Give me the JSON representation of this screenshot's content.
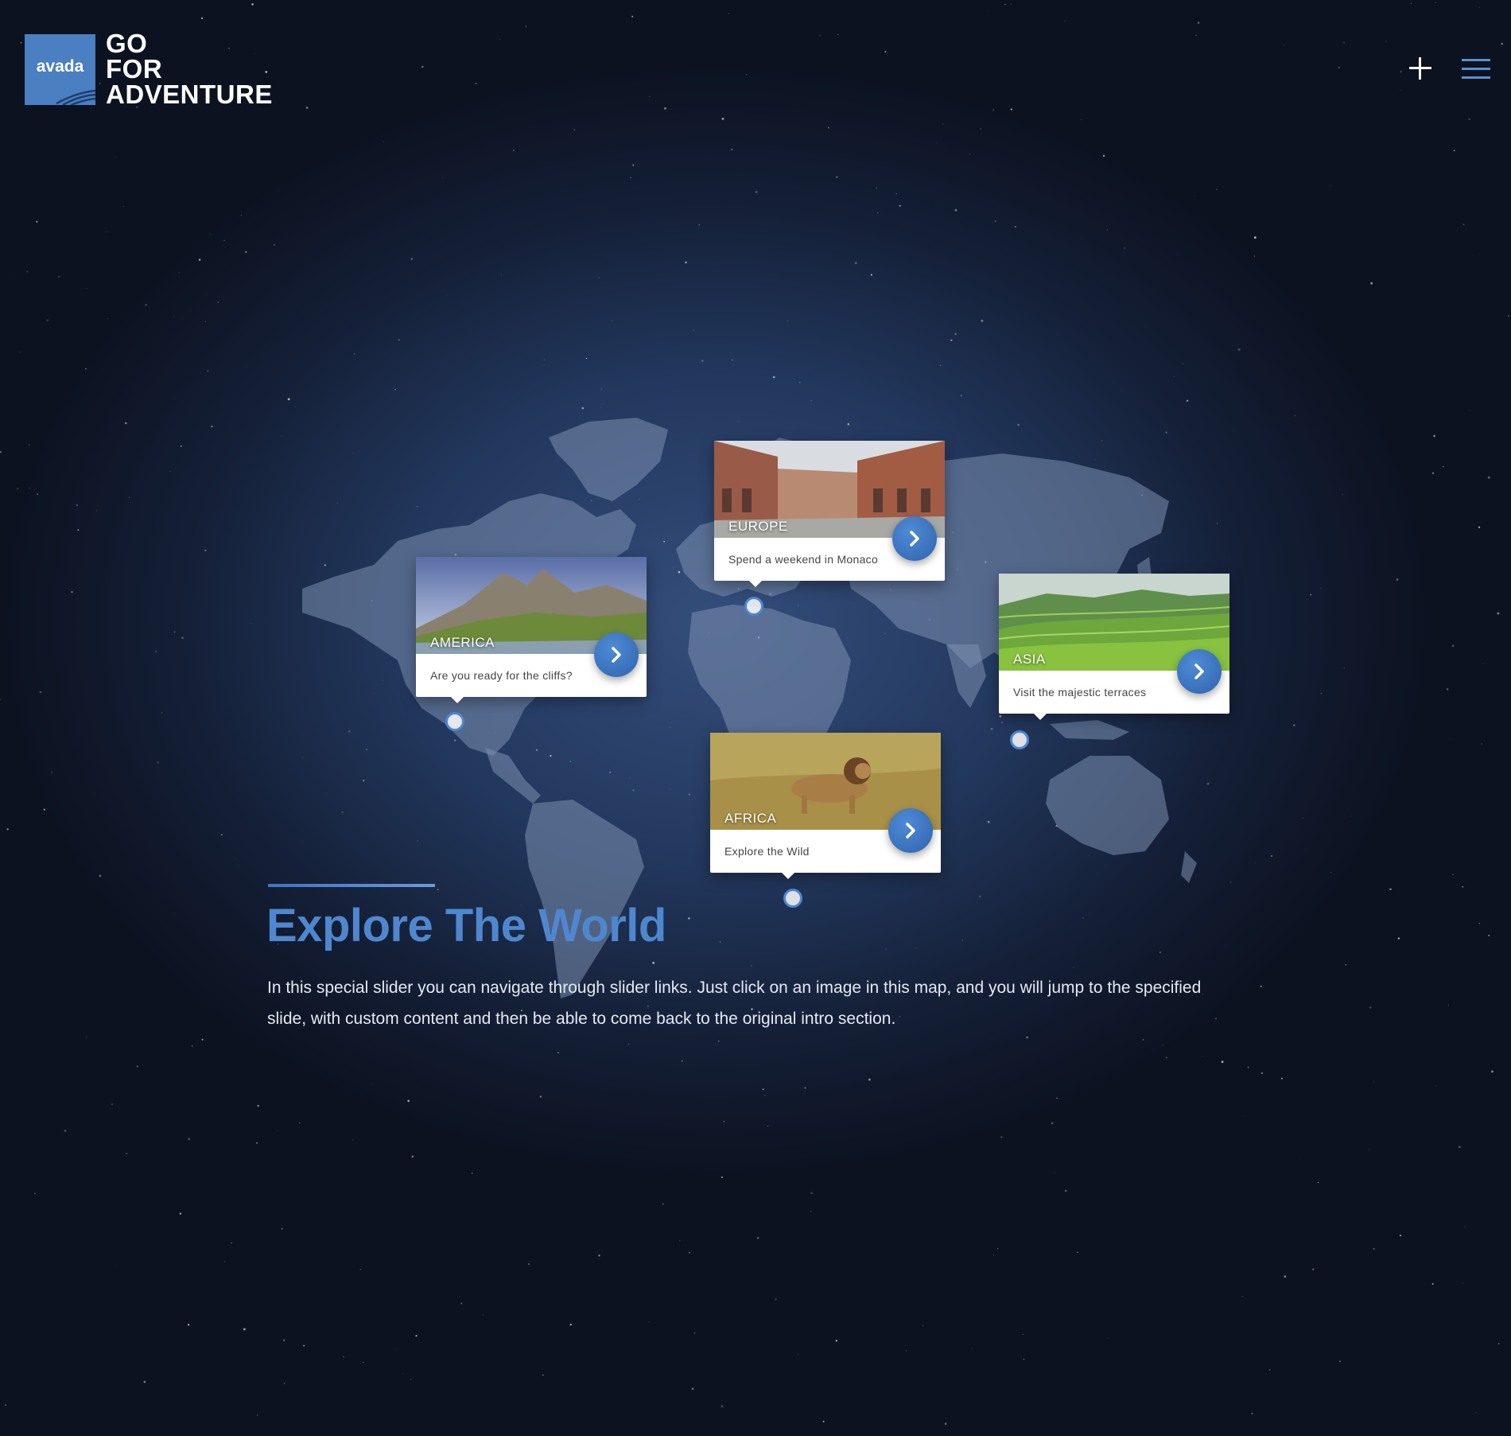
{
  "brand": {
    "logo_mark": "avada",
    "tagline_lines": [
      "GO",
      "FOR",
      "ADVENTURE"
    ],
    "accent_color": "#4a7fc1"
  },
  "header": {
    "plus_icon": "plus-icon",
    "menu_icon": "hamburger-menu-icon"
  },
  "destinations": [
    {
      "region": "AMERICA",
      "caption": "Are you ready for the cliffs?"
    },
    {
      "region": "EUROPE",
      "caption": "Spend a weekend in Monaco"
    },
    {
      "region": "ASIA",
      "caption": "Visit the majestic terraces"
    },
    {
      "region": "AFRICA",
      "caption": "Explore the Wild"
    }
  ],
  "intro": {
    "title": "Explore The World",
    "body": "In this special slider you can navigate through slider links. Just click on an image in this map, and you will jump to the specified slide, with custom content and then be able to come back to the original intro section.",
    "title_color": "#4f87cf"
  }
}
